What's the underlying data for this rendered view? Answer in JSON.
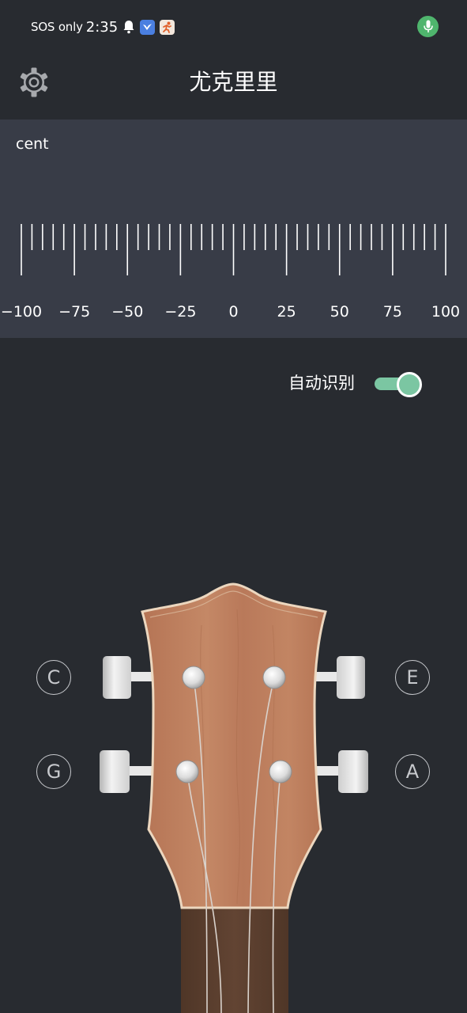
{
  "status_bar": {
    "carrier": "SOS only",
    "time": "2:35",
    "icons": [
      "bell-icon",
      "app-notification-icon",
      "fitness-app-icon"
    ],
    "mic_icon": "microphone-icon",
    "mic_color": "#4fb56d"
  },
  "app_bar": {
    "title": "尤克里里",
    "settings_icon": "gear-icon"
  },
  "tuner": {
    "unit_label": "cent",
    "scale_min": -100,
    "scale_max": 100,
    "tick_labels": [
      "−100",
      "−75",
      "−50",
      "−25",
      "0",
      "25",
      "50",
      "75",
      "100"
    ]
  },
  "auto_detect": {
    "label": "自动识别",
    "enabled": true,
    "accent": "#7bc6a2"
  },
  "strings": {
    "upper_left": "C",
    "upper_right": "E",
    "lower_left": "G",
    "lower_right": "A"
  },
  "colors": {
    "background": "#282b30",
    "meter_background": "#383c47",
    "headstock_wood": "#b87a58",
    "fretboard": "#5a3f2f"
  }
}
